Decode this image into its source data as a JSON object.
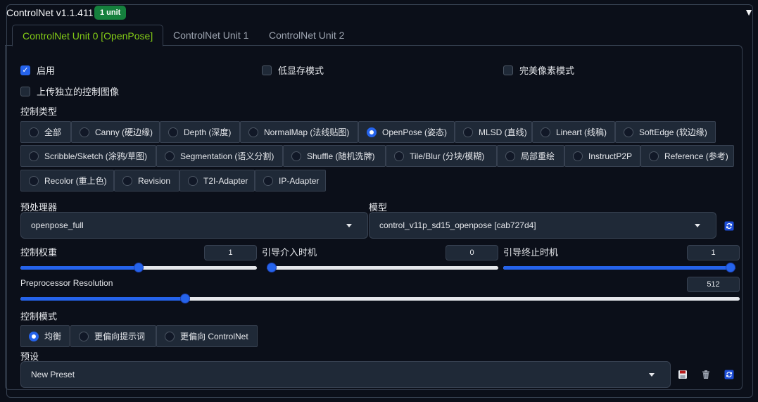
{
  "header": {
    "title": "ControlNet v1.1.411",
    "badge": "1 unit"
  },
  "tabs": [
    "ControlNet Unit 0 [OpenPose]",
    "ControlNet Unit 1",
    "ControlNet Unit 2"
  ],
  "checks": {
    "enable": {
      "label": "启用",
      "checked": true
    },
    "low_vram": {
      "label": "低显存模式",
      "checked": false
    },
    "pixel_perfect": {
      "label": "完美像素模式",
      "checked": false
    },
    "upload_independent": {
      "label": "上传独立的控制图像",
      "checked": false
    }
  },
  "control_type": {
    "label": "控制类型",
    "selected": "OpenPose (姿态)",
    "options": [
      "全部",
      "Canny (硬边缘)",
      "Depth (深度)",
      "NormalMap (法线贴图)",
      "OpenPose (姿态)",
      "MLSD (直线)",
      "Lineart (线稿)",
      "SoftEdge (软边缘)",
      "Scribble/Sketch (涂鸦/草图)",
      "Segmentation (语义分割)",
      "Shuffle (随机洗牌)",
      "Tile/Blur (分块/模糊)",
      "局部重绘",
      "InstructP2P",
      "Reference (参考)",
      "Recolor (重上色)",
      "Revision",
      "T2I-Adapter",
      "IP-Adapter"
    ]
  },
  "preprocessor": {
    "label": "预处理器",
    "value": "openpose_full"
  },
  "model": {
    "label": "模型",
    "value": "control_v11p_sd15_openpose [cab727d4]"
  },
  "sliders": {
    "weight": {
      "label": "控制权重",
      "value": "1",
      "fraction": 0.5
    },
    "start": {
      "label": "引导介入时机",
      "value": "0",
      "fraction": 0.0
    },
    "end": {
      "label": "引导终止时机",
      "value": "1",
      "fraction": 1.0
    },
    "resolution": {
      "label": "Preprocessor Resolution",
      "value": "512",
      "fraction": 0.229
    }
  },
  "control_mode": {
    "label": "控制模式",
    "selected": "均衡",
    "options": [
      "均衡",
      "更偏向提示词",
      "更偏向 ControlNet"
    ]
  },
  "preset": {
    "label": "预设",
    "value": "New Preset"
  },
  "colors": {
    "accent": "#2563eb",
    "tab_active": "#84cc16",
    "badge": "#15803d"
  },
  "icons": [
    "refresh-icon",
    "save-icon",
    "trash-icon",
    "chevron-down-icon",
    "collapse-triangle-icon"
  ]
}
